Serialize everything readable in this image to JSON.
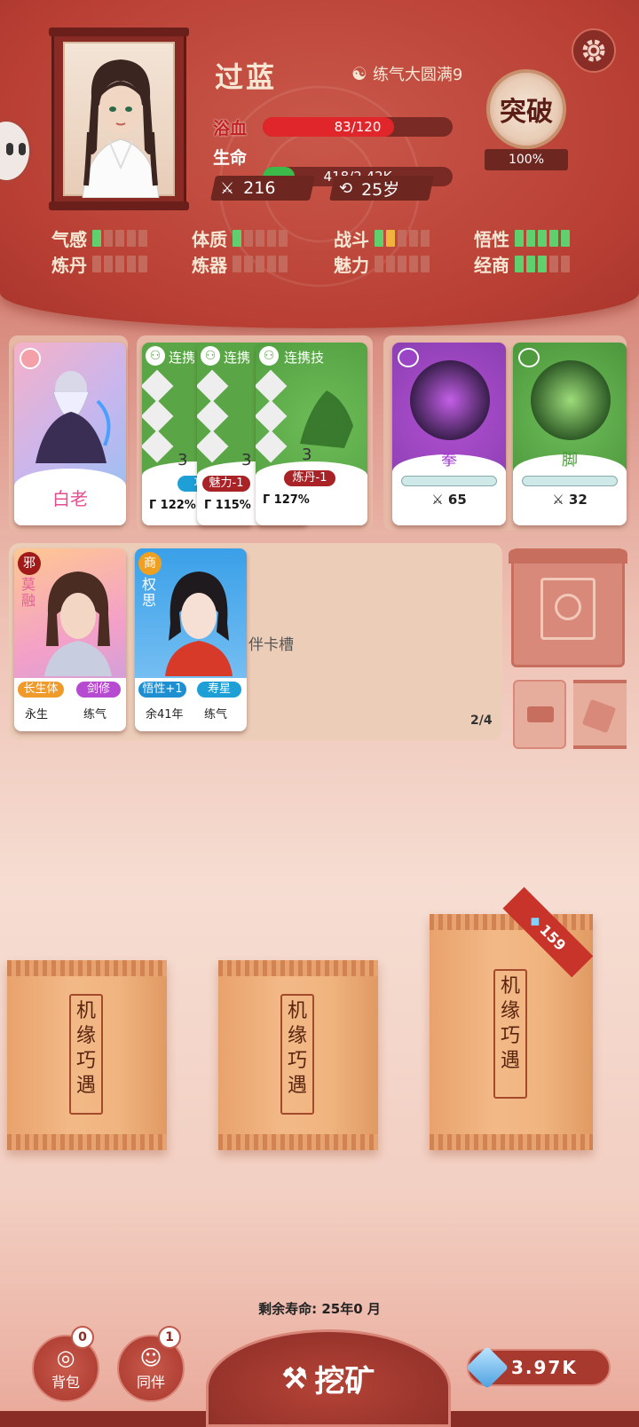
{
  "header": {
    "name": "过蓝",
    "realm": "练气大圆满9",
    "status_label": "浴血",
    "hp_label": "生命",
    "blood_value": "83/120",
    "blood_fraction": 0.69,
    "hp_value": "418/2.42K",
    "hp_fraction": 0.17,
    "power": "216",
    "age": "25岁",
    "breakthrough_label": "突破",
    "breakthrough_pct": "100%"
  },
  "attributes": [
    {
      "label": "气感"
    },
    {
      "label": "体质"
    },
    {
      "label": "战斗"
    },
    {
      "label": "悟性"
    },
    {
      "label": "炼丹"
    },
    {
      "label": "炼器"
    },
    {
      "label": "魅力"
    },
    {
      "label": "经商"
    }
  ],
  "cards": {
    "master": {
      "name": "白老"
    },
    "combo": {
      "title": "连携技",
      "title_short": "连携",
      "back1_level": "3",
      "back1_tag": "巧",
      "back1_pct": "122%",
      "back2_level": "3",
      "back2_tag": "魅力-1",
      "back2_pct": "115%",
      "front_level": "3",
      "front_tag": "炼丹-1",
      "front_pct": "127%"
    },
    "fist": {
      "name": "拳",
      "power": "65"
    },
    "foot": {
      "name": "脚",
      "power": "32"
    }
  },
  "companions": {
    "slot_label": "伴卡槽",
    "count": "2/4",
    "items": [
      {
        "faction": "邪",
        "name_line1": "莫",
        "name_line2": "融",
        "tag1": "长生体",
        "tag2": "剑修",
        "life": "永生",
        "realm": "练气"
      },
      {
        "faction": "商",
        "name_line1": "权",
        "name_line2": "思",
        "tag1": "悟性+1",
        "tag2": "寿星",
        "life": "余41年",
        "realm": "练气"
      }
    ]
  },
  "packs": {
    "label_chars": [
      "机",
      "缘",
      "巧",
      "遇"
    ],
    "price": "159"
  },
  "footer": {
    "lifespan": "剩余寿命: 25年0 月",
    "bag_label": "背包",
    "bag_count": "0",
    "companion_label": "同伴",
    "companion_count": "1",
    "mine_label": "挖矿",
    "spirit_stones": "3.97K"
  },
  "colors": {
    "accent_red": "#b93f34",
    "pip_green": "#5fd06d",
    "pip_yellow": "#f1b33d",
    "blood_bar": "#e0262a",
    "hp_bar": "#3dbb4a"
  }
}
